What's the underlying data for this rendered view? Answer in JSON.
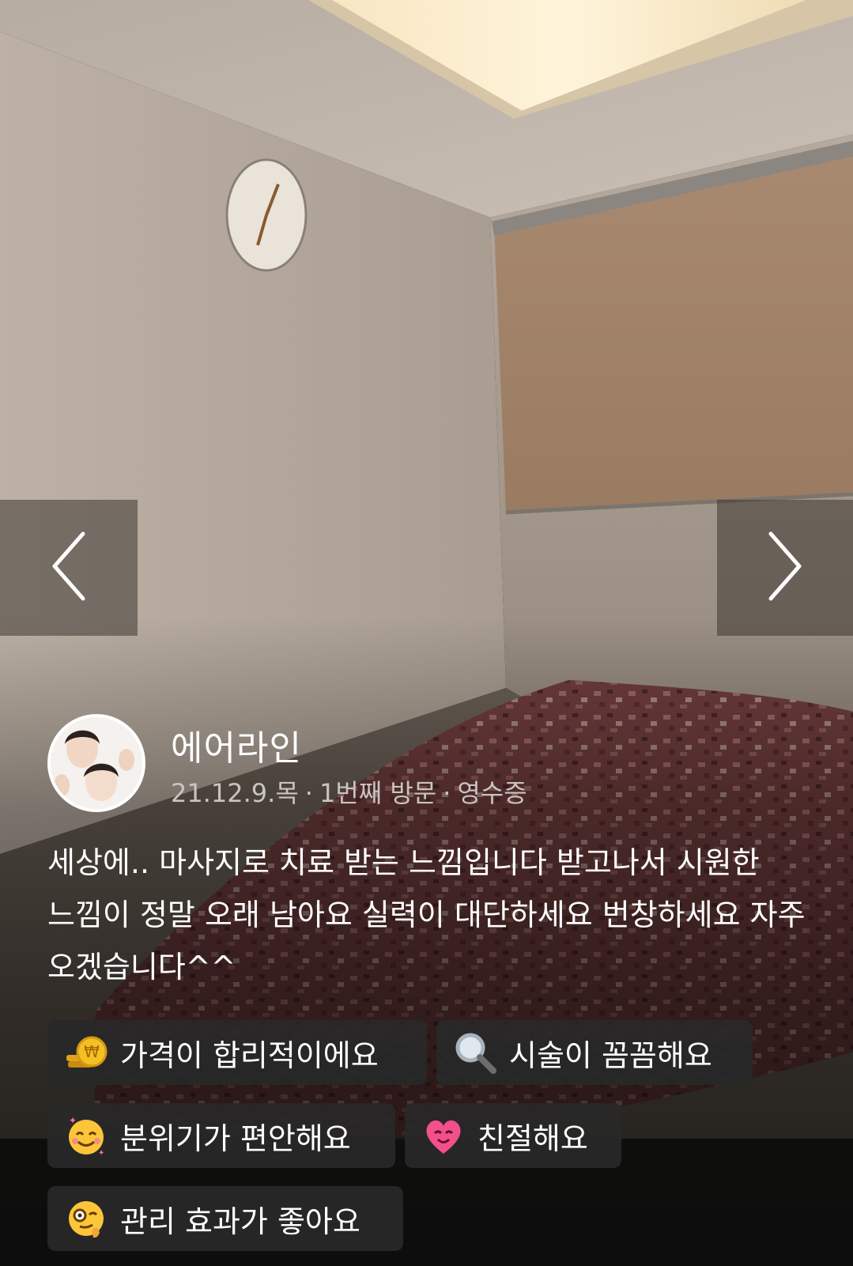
{
  "reviewer": {
    "name": "에어라인",
    "date": "21.12.9.목",
    "visit": "1번째 방문",
    "verification": "영수증",
    "separator": "·"
  },
  "review": {
    "text": "세상에.. 마사지로 치료 받는 느낌입니다 받고나서 시원한 느낌이 정말 오래 남아요 실력이 대단하세요 번창하세요 자주 오겠습니다^^"
  },
  "tags": [
    {
      "label": "가격이 합리적이에요",
      "icon": "coin-icon"
    },
    {
      "label": "시술이 꼼꼼해요",
      "icon": "magnifier-icon"
    },
    {
      "label": "분위기가 편안해요",
      "icon": "smiling-face-icon"
    },
    {
      "label": "친절해요",
      "icon": "heart-face-icon"
    },
    {
      "label": "관리 효과가 좋아요",
      "icon": "monocle-face-icon"
    }
  ],
  "nav": {
    "prev_icon": "chevron-left-icon",
    "next_icon": "chevron-right-icon"
  }
}
